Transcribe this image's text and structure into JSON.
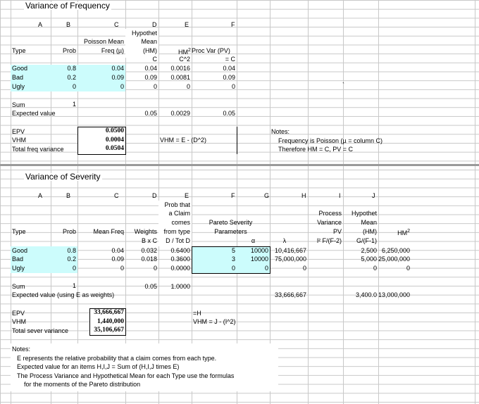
{
  "freq": {
    "title": "Variance of Frequency",
    "col_letters": [
      "A",
      "B",
      "C",
      "D",
      "E",
      "F"
    ],
    "h_hypothet": "Hypothet",
    "h_mean": "Mean",
    "h_hm": "(HM)",
    "h_hm_sub": "C",
    "h_poisson": "Poisson Mean",
    "h_freq": "Freq (µ)",
    "h_type": "Type",
    "h_prob": "Prob",
    "h_hm2": "HM",
    "h_hm2_sup": "2",
    "h_c2": "C^2",
    "h_procvar": "Proc Var (PV)",
    "h_eqc": "= C",
    "rows": [
      {
        "type": "Good",
        "prob": "0.8",
        "freq": "0.04",
        "hm": "0.04",
        "hm2": "0.0016",
        "pv": "0.04"
      },
      {
        "type": "Bad",
        "prob": "0.2",
        "freq": "0.09",
        "hm": "0.09",
        "hm2": "0.0081",
        "pv": "0.09"
      },
      {
        "type": "Ugly",
        "prob": "0",
        "freq": "0",
        "hm": "0",
        "hm2": "0",
        "pv": "0"
      }
    ],
    "sum_label": "Sum",
    "sum_value": "1",
    "ev_label": "Expected value",
    "ev_hm": "0.05",
    "ev_hm2": "0.0029",
    "ev_pv": "0.05",
    "epv_label": "EPV",
    "vhm_label": "VHM",
    "tfv_label": "Total freq variance",
    "epv": "0.0500",
    "vhm": "0.0004",
    "tfv": "0.0504",
    "vhm_formula": "VHM = E - (D^2)",
    "notes_title": "Notes:",
    "note1": "Frequency is Poisson (µ = column C)",
    "note2": "Therefore HM = C, PV = C",
    "tick": "`"
  },
  "sev": {
    "title": "Variance of Severity",
    "col_letters": [
      "A",
      "B",
      "C",
      "D",
      "E",
      "F",
      "G",
      "H",
      "I",
      "J"
    ],
    "h_probthat": "Prob that",
    "h_aclaim": "a Claim",
    "h_comes": "comes",
    "h_fromtype": "from type",
    "h_dtot": "D / Tot D",
    "h_pareto": "Pareto Severity",
    "h_params": "Parameters",
    "h_alpha": "α",
    "h_lambda": "λ",
    "h_process": "Process",
    "h_variance": "Variance",
    "h_pv": "PV",
    "h_pvform": "l² F/(F-2)",
    "h_hypothet": "Hypothet",
    "h_mean": "Mean",
    "h_hm": "(HM)",
    "h_hmform": "G/(F-1)",
    "h_hm2": "HM",
    "h_hm2_sup": "2",
    "h_type": "Type",
    "h_prob": "Prob",
    "h_meanfreq": "Mean Freq",
    "h_weights": "Weights",
    "h_bxc": "B x C",
    "rows": [
      {
        "type": "Good",
        "prob": "0.8",
        "freq": "0.04",
        "w": "0.032",
        "e": "0.6400",
        "a": "5",
        "l": "10000",
        "pv": "10,416,667",
        "hm": "2,500",
        "hm2": "6,250,000"
      },
      {
        "type": "Bad",
        "prob": "0.2",
        "freq": "0.09",
        "w": "0.018",
        "e": "0.3600",
        "a": "3",
        "l": "10000",
        "pv": "75,000,000",
        "hm": "5,000",
        "hm2": "25,000,000"
      },
      {
        "type": "Ugly",
        "prob": "0",
        "freq": "0",
        "w": "0",
        "e": "0.0000",
        "a": "0",
        "l": "0",
        "pv": "0",
        "hm": "0",
        "hm2": "0"
      }
    ],
    "sum_label": "Sum",
    "sum_value": "1",
    "sum_w": "0.05",
    "sum_e": "1.0000",
    "ev_label": "Expected value (using E as weights)",
    "ev_pv": "33,666,667",
    "ev_hm": "3,400.0",
    "ev_hm2": "13,000,000",
    "epv_label": "EPV",
    "vhm_label": "VHM",
    "tsv_label": "Total sever variance",
    "epv": "33,666,667",
    "vhm": "1,440,000",
    "tsv": "35,106,667",
    "eq_h": "=H",
    "vhm_formula": "VHM = J - (I^2)",
    "notes_title": "Notes:",
    "note1": "E represents the relative probability that a claim comes from each type.",
    "note2": "Expected value for an items H,I,J = Sum of (H,I,J times E)",
    "note3": "The Process Variance and Hypothetical Mean for each Type use the formulas",
    "note4": "for the moments of the Pareto distribution"
  }
}
